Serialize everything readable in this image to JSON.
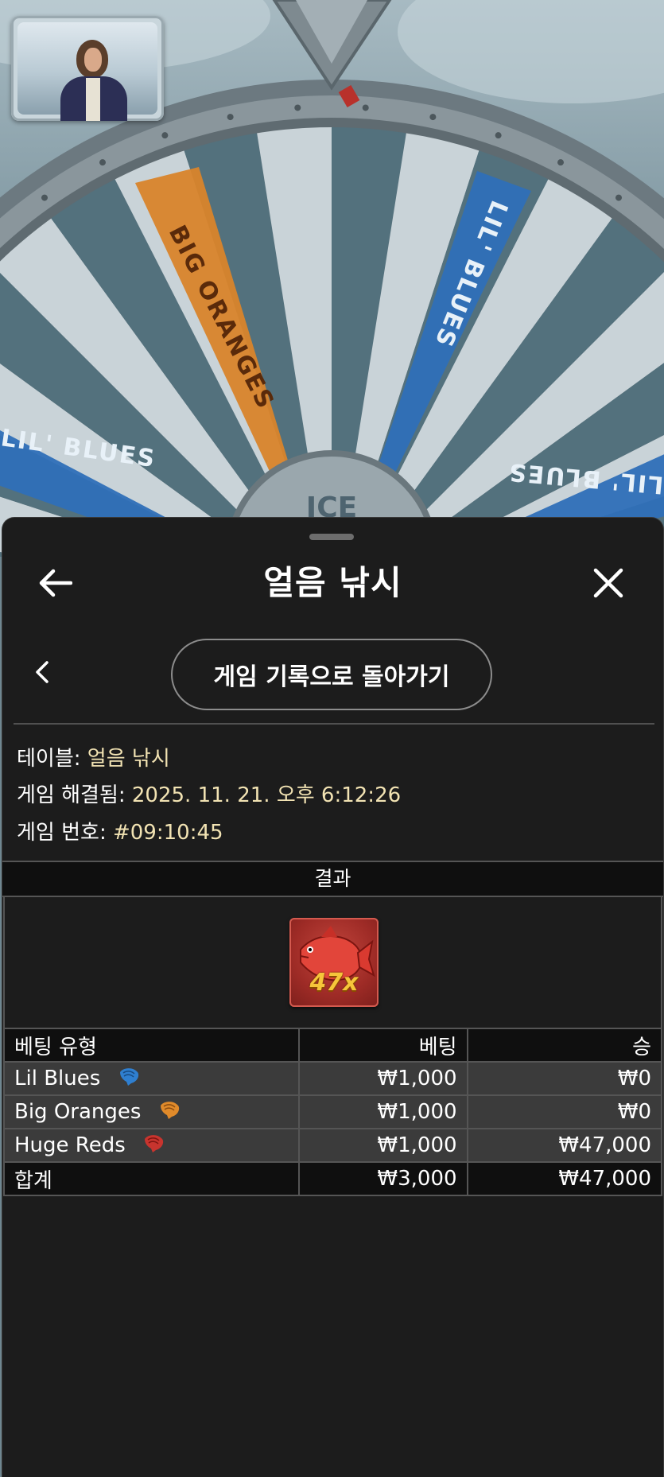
{
  "header": {
    "title": "얼음 낚시",
    "back_button_label": "게임 기록으로 돌아가기"
  },
  "background": {
    "wheel_segments": [
      "BIG ORANGES",
      "LIL' BLUES",
      "LIL' BLUES",
      "LIL' BLUES"
    ],
    "hub_label": "ICE"
  },
  "info": {
    "table_label": "테이블:",
    "table_value": "얼음 낚시",
    "resolved_label": "게임 해결됨:",
    "resolved_value": "2025. 11. 21. 오후 6:12:26",
    "game_no_label": "게임 번호:",
    "game_no_value": "#09:10:45"
  },
  "result": {
    "header": "결과",
    "multiplier": "47x",
    "fish": "huge-red-fish"
  },
  "bets_table": {
    "columns": [
      "베팅 유형",
      "베팅",
      "승"
    ],
    "rows": [
      {
        "type": "Lil Blues",
        "icon": "blue-shrimp-icon",
        "icon_color": "#2f7fd0",
        "bet": "₩1,000",
        "win": "₩0"
      },
      {
        "type": "Big Oranges",
        "icon": "orange-shrimp-icon",
        "icon_color": "#e08a2a",
        "bet": "₩1,000",
        "win": "₩0"
      },
      {
        "type": "Huge Reds",
        "icon": "red-shrimp-icon",
        "icon_color": "#c8342e",
        "bet": "₩1,000",
        "win": "₩47,000"
      }
    ],
    "total": {
      "label": "합계",
      "bet": "₩3,000",
      "win": "₩47,000"
    }
  },
  "colors": {
    "sheet_bg": "#1c1c1c",
    "value_text": "#f2e3b3",
    "row_bg": "#3b3b3b",
    "header_bg": "#0f0f0f"
  }
}
